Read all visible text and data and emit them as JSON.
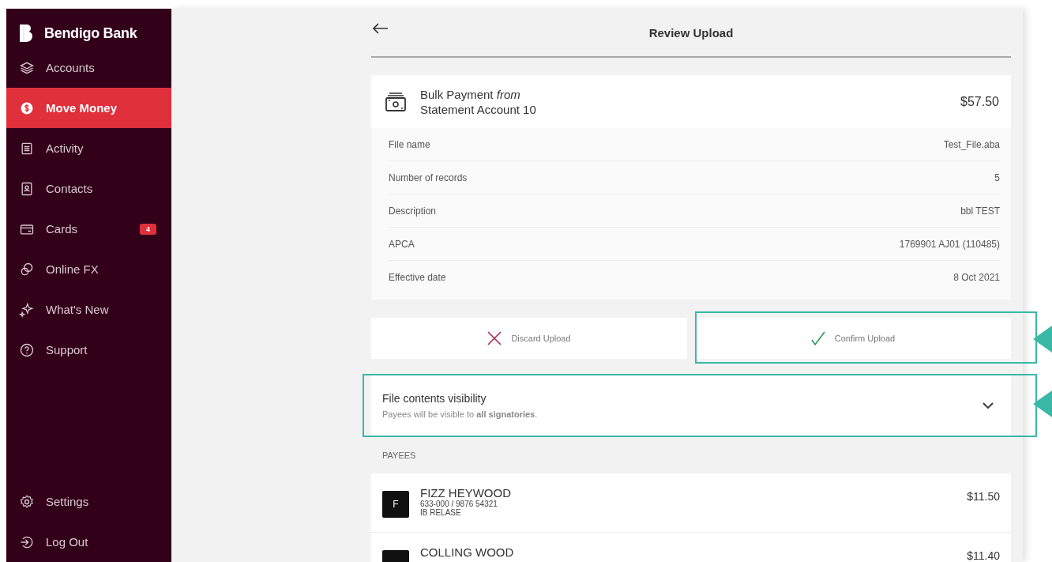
{
  "brand": {
    "name": "Bendigo Bank"
  },
  "sidebar": {
    "items": [
      {
        "label": "Accounts",
        "selected": false
      },
      {
        "label": "Move Money",
        "selected": true
      },
      {
        "label": "Activity",
        "selected": false
      },
      {
        "label": "Contacts",
        "selected": false
      },
      {
        "label": "Cards",
        "selected": false,
        "badge": "4"
      },
      {
        "label": "Online FX",
        "selected": false
      },
      {
        "label": "What's New",
        "selected": false
      },
      {
        "label": "Support",
        "selected": false
      }
    ],
    "bottom_items": [
      {
        "label": "Settings"
      },
      {
        "label": "Log Out"
      }
    ]
  },
  "header": {
    "title": "Review Upload"
  },
  "summary": {
    "title": "Bulk Payment *from*",
    "account": "Statement Account 10",
    "amount": "$57.50",
    "details": [
      {
        "label": "File name",
        "value": "Test_File.aba"
      },
      {
        "label": "Number of records",
        "value": "5"
      },
      {
        "label": "Description",
        "value": "bbl TEST"
      },
      {
        "label": "APCA",
        "value": "1769901 AJ01 (110485)"
      },
      {
        "label": "Effective date",
        "value": "8 Oct 2021"
      }
    ]
  },
  "actions": [
    {
      "kind": "discard",
      "label": "Discard Upload",
      "highlighted": false
    },
    {
      "kind": "confirm",
      "label": "Confirm Upload",
      "highlighted": true
    }
  ],
  "visibility": {
    "title": "File contents visibility",
    "note": "Payees will be visible to **all signatories**.",
    "expanded": false,
    "highlighted": true
  },
  "payees": {
    "heading": "PAYEES",
    "items": [
      {
        "initial": "F",
        "name": "FIZZ HEYWOOD",
        "account": "633-000 / 9876 54321",
        "reference": "IB RELASE",
        "amount": "$11.50"
      },
      {
        "name": "COLLING WOOD",
        "amount": "$11.40"
      }
    ]
  }
}
